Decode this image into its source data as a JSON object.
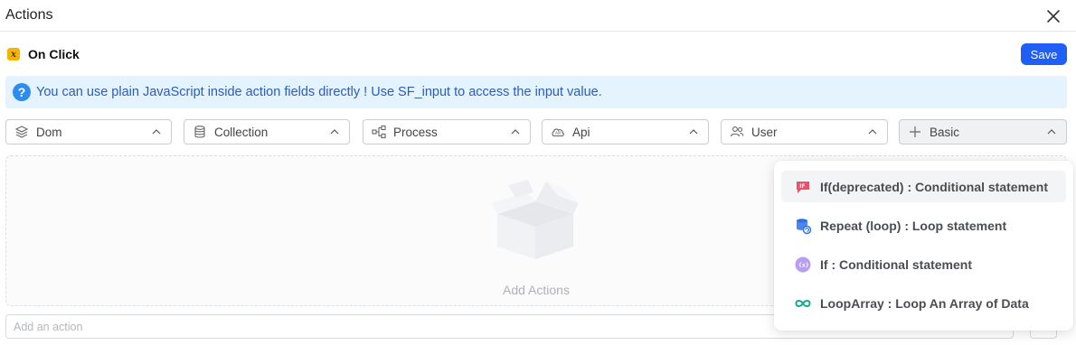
{
  "header": {
    "title": "Actions"
  },
  "event": {
    "badge": "x",
    "label": "On Click"
  },
  "toolbar": {
    "save_label": "Save"
  },
  "info": {
    "icon": "?",
    "text": "You can use plain JavaScript inside action fields directly ! Use SF_input to access the input value."
  },
  "dropdowns": [
    {
      "label": "Dom",
      "icon": "layers-icon"
    },
    {
      "label": "Collection",
      "icon": "database-icon"
    },
    {
      "label": "Process",
      "icon": "flow-icon"
    },
    {
      "label": "Api",
      "icon": "cloud-api-icon"
    },
    {
      "label": "User",
      "icon": "users-icon"
    },
    {
      "label": "Basic",
      "icon": "plus-icon"
    }
  ],
  "drop_area": {
    "empty_text": "Add Actions"
  },
  "add_action": {
    "placeholder": "Add an action"
  },
  "basic_menu": {
    "items": [
      {
        "label": "If(deprecated) : Conditional statement",
        "icon": "if-deprecated-icon",
        "color": "#e8536a"
      },
      {
        "label": "Repeat (loop) : Loop statement",
        "icon": "repeat-loop-icon",
        "color": "#2f6fe0"
      },
      {
        "label": "If : Conditional statement",
        "icon": "if-conditional-icon",
        "color": "#9b7ae6"
      },
      {
        "label": "LoopArray : Loop An Array of Data",
        "icon": "loop-array-icon",
        "color": "#15a88a"
      }
    ]
  },
  "colors": {
    "accent": "#1f5ff5",
    "info_bg": "#e4f3fd",
    "info_text": "#2a5eb8",
    "event_badge": "#f5b400"
  }
}
